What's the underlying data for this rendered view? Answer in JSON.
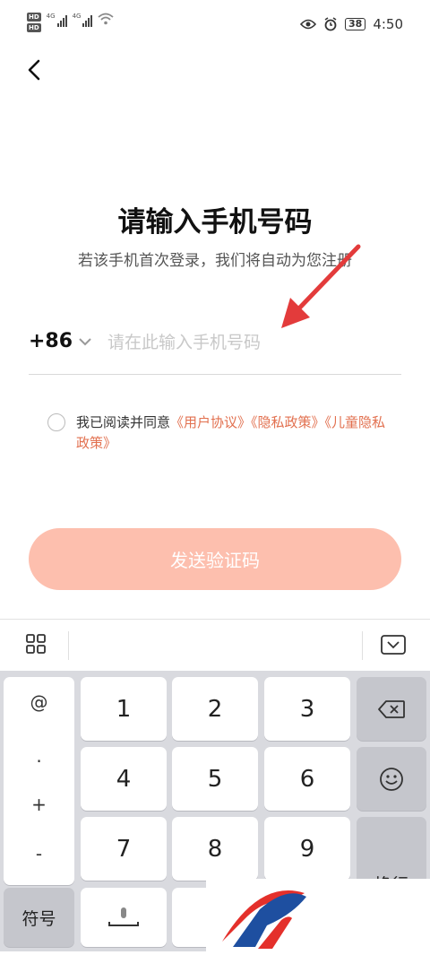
{
  "status_bar": {
    "hd1": "HD",
    "hd2": "HD",
    "net1": "4G",
    "net2": "4G",
    "battery": "38",
    "time": "4:50",
    "icons": [
      "eye-icon",
      "alarm-icon"
    ]
  },
  "header": {
    "title": "请输入手机号码",
    "subtitle": "若该手机首次登录，我们将自动为您注册"
  },
  "phone": {
    "country_code": "+86",
    "placeholder": "请在此输入手机号码",
    "value": ""
  },
  "agreement": {
    "prefix": "我已阅读并同意",
    "link1": "《用户协议》",
    "link2": "《隐私政策》",
    "link3": "《儿童隐私政策》",
    "checked": false
  },
  "send_button": {
    "label": "发送验证码",
    "color": "#fdbfae"
  },
  "keyboard": {
    "symbols": [
      "@",
      ".",
      "+",
      "-"
    ],
    "digits": [
      "1",
      "2",
      "3",
      "4",
      "5",
      "6",
      "7",
      "8",
      "9"
    ],
    "symbol_key": "符号",
    "enter_key": "换行"
  },
  "accent_color": "#e2704f"
}
